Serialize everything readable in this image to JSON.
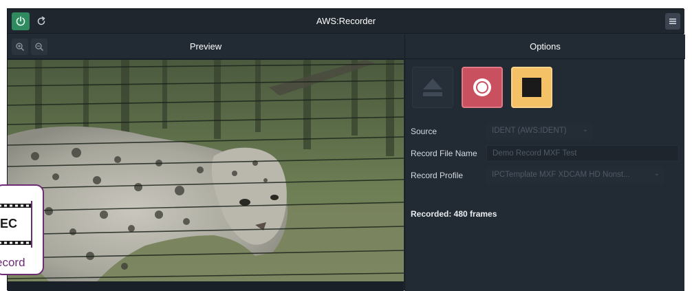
{
  "app": {
    "title": "AWS:Recorder"
  },
  "titlebar": {
    "power_icon": "power-icon",
    "refresh_icon": "refresh-icon",
    "menu_icon": "hamburger-menu-icon"
  },
  "preview": {
    "title": "Preview",
    "zoom_in_icon": "zoom-in-icon",
    "zoom_out_icon": "zoom-out-icon"
  },
  "options": {
    "title": "Options",
    "buttons": {
      "eject_icon": "eject-icon",
      "record_icon": "record-icon",
      "stop_icon": "stop-icon"
    },
    "fields": {
      "source": {
        "label": "Source",
        "value": "IDENT (AWS:IDENT)"
      },
      "record_file_name": {
        "label": "Record File Name",
        "value": "Demo Record MXF Test"
      },
      "record_profile": {
        "label": "Record Profile",
        "value": "IPCTemplate MXF XDCAM HD Nonst..."
      }
    },
    "status": "Recorded: 480 frames"
  },
  "badge": {
    "text": "EC",
    "caption": "ecord"
  },
  "colors": {
    "accent_green": "#2f8a5f",
    "record_red": "#c9505f",
    "stop_yellow": "#f5c167",
    "badge_purple": "#6d2b76"
  }
}
